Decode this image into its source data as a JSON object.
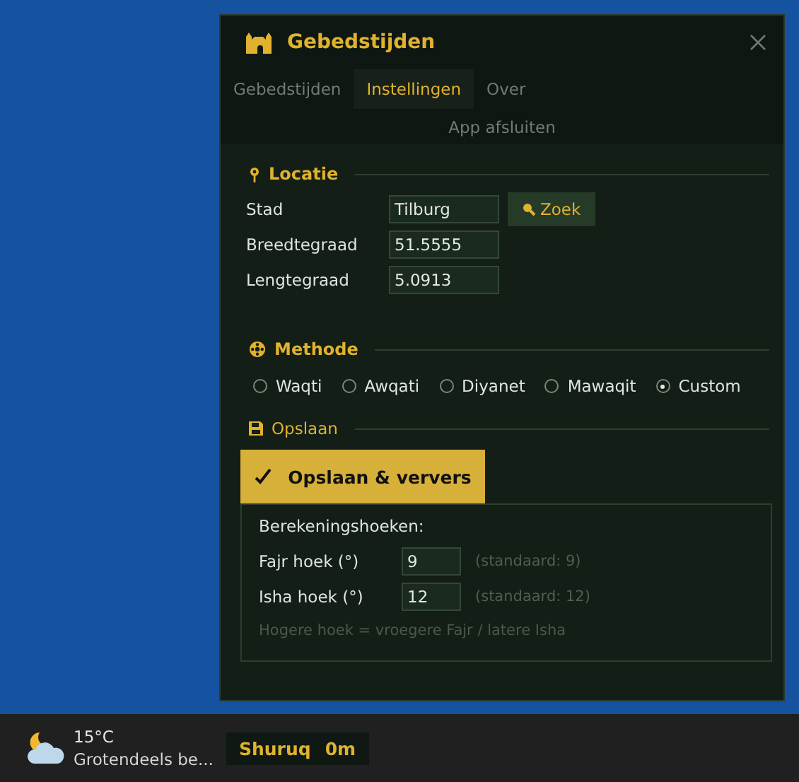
{
  "window": {
    "title": "Gebedstijden"
  },
  "tabs": [
    {
      "label": "Gebedstijden",
      "selected": false
    },
    {
      "label": "Instellingen",
      "selected": true
    },
    {
      "label": "Over",
      "selected": false
    }
  ],
  "close_app": "App afsluiten",
  "location": {
    "heading": "Locatie",
    "search_button": "Zoek",
    "fields": [
      {
        "label": "Stad",
        "value": "Tilburg"
      },
      {
        "label": "Breedtegraad",
        "value": "51.5555"
      },
      {
        "label": "Lengtegraad",
        "value": "5.0913"
      }
    ]
  },
  "method": {
    "heading": "Methode",
    "options": [
      {
        "label": "Waqti",
        "selected": false
      },
      {
        "label": "Awqati",
        "selected": false
      },
      {
        "label": "Diyanet",
        "selected": false
      },
      {
        "label": "Mawaqit",
        "selected": false
      },
      {
        "label": "Custom",
        "selected": true
      }
    ]
  },
  "save": {
    "heading": "Opslaan",
    "button": "Opslaan & ververs"
  },
  "angles": {
    "heading": "Berekeningshoeken:",
    "rows": [
      {
        "label": "Fajr hoek (°)",
        "value": "9",
        "hint": "(standaard: 9)"
      },
      {
        "label": "Isha hoek (°)",
        "value": "12",
        "hint": "(standaard: 12)"
      }
    ],
    "note": "Hogere hoek = vroegere Fajr / latere Isha"
  },
  "taskbar": {
    "weather": {
      "temp": "15°C",
      "description": "Grotendeels be..."
    },
    "prayer": {
      "name": "Shuruq",
      "time": "0m"
    }
  }
}
